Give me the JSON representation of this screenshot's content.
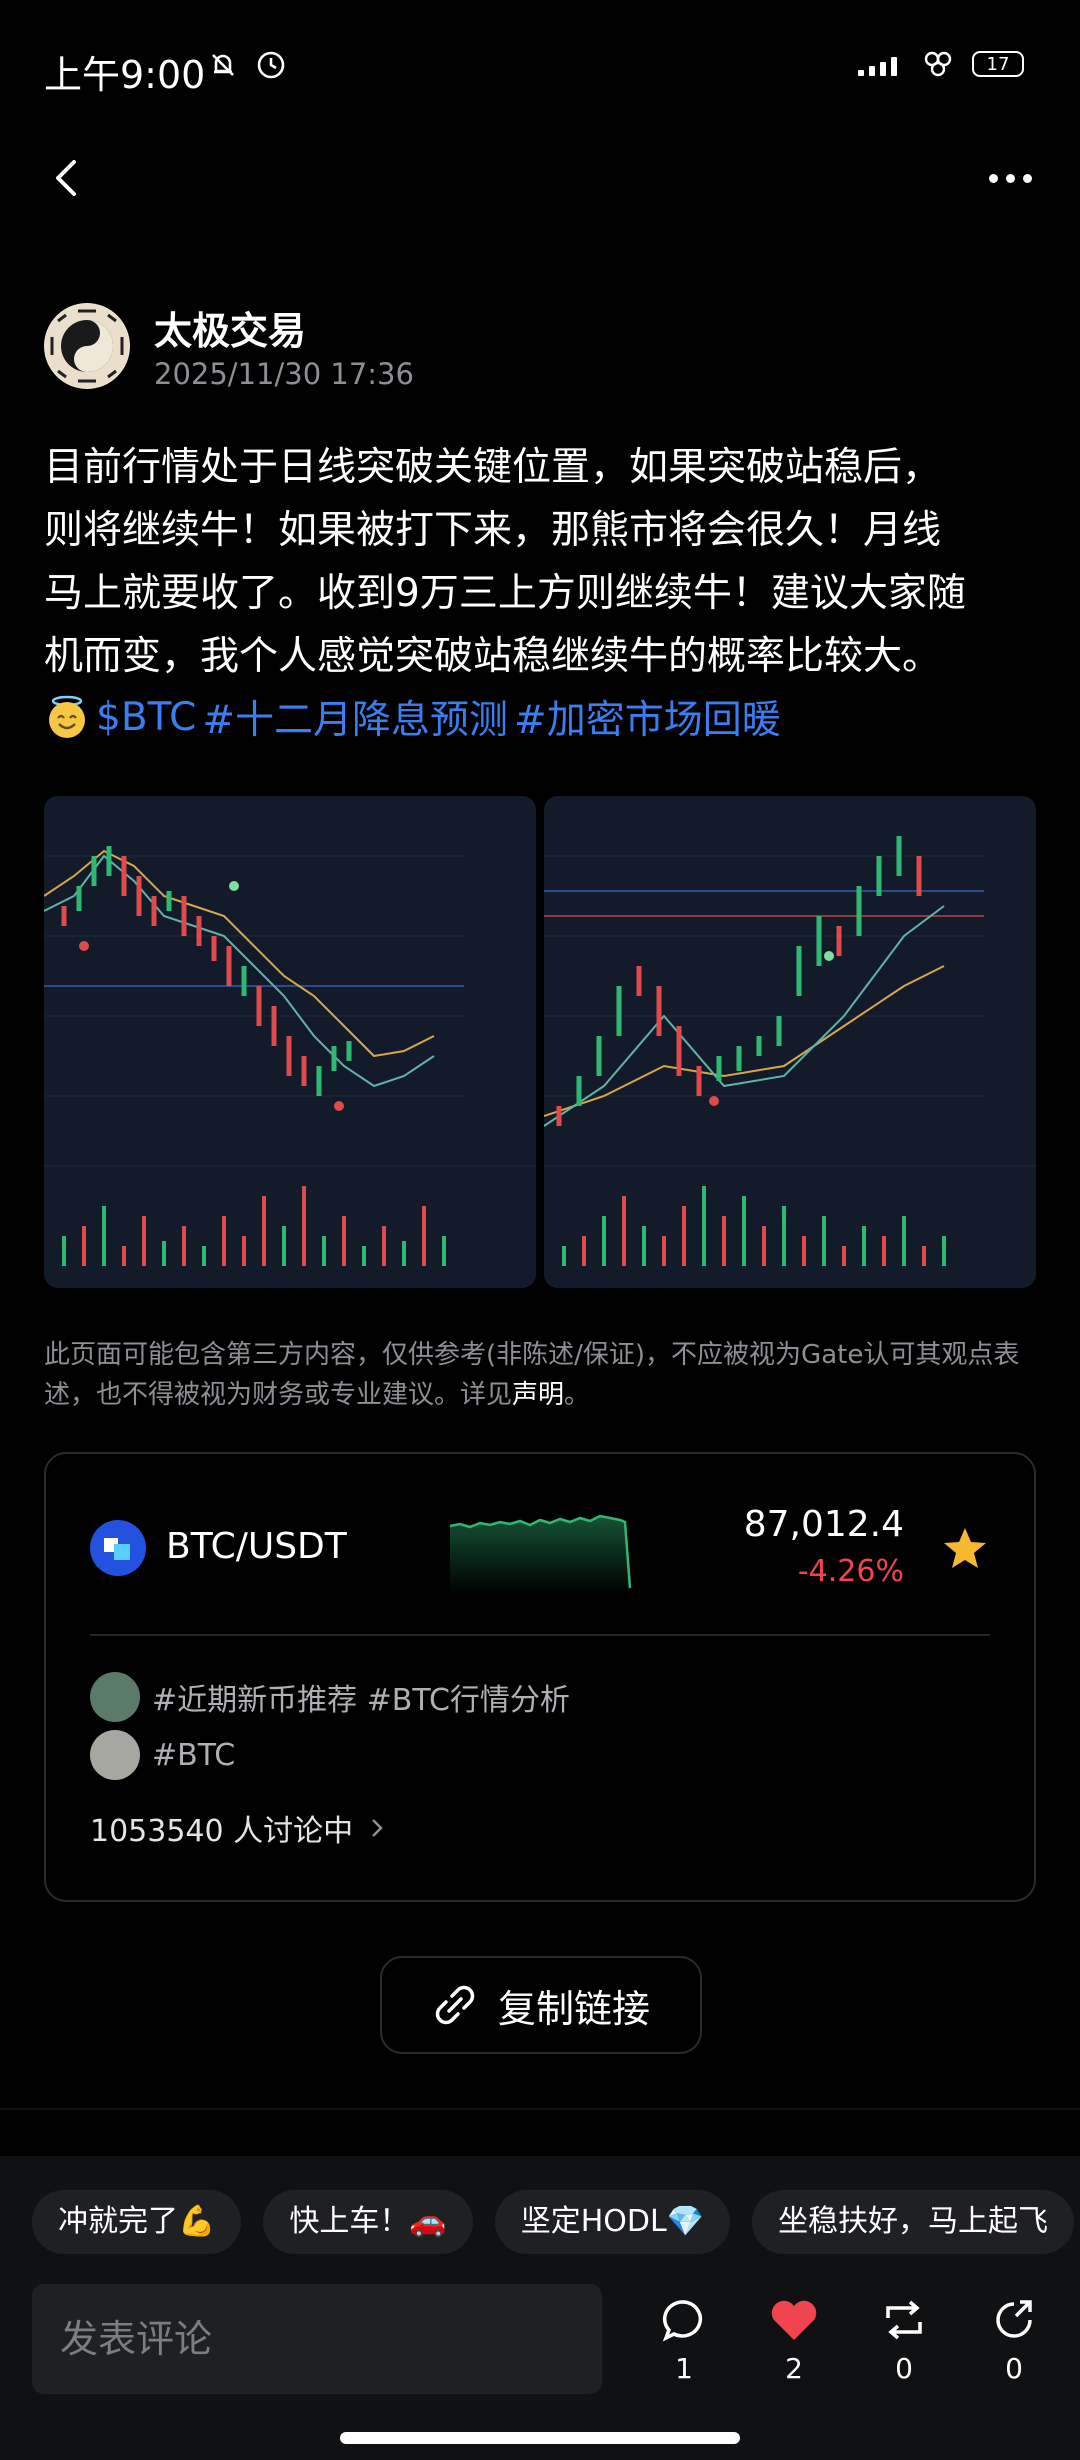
{
  "status_bar": {
    "time": "上午9:00",
    "battery": "17"
  },
  "author": {
    "name": "太极交易",
    "time": "2025/11/30 17:36"
  },
  "post": {
    "lines": [
      "目前行情处于日线突破关键位置，如果突破站稳后，",
      "则将继续牛！如果被打下来，那熊市将会很久！月线",
      "马上就要收了。收到9万三上方则继续牛！建议大家随",
      "机而变，我个人感觉突破站稳继续牛的概率比较大。"
    ],
    "tags": [
      "$BTC",
      "#十二月降息预测",
      "#加密市场回暖"
    ]
  },
  "disclaimer": {
    "text": "此页面可能包含第三方内容，仅供参考(非陈述/保证)，不应被视为Gate认可其观点表述，也不得被视为财务或专业建议。详见",
    "link": "声明",
    "end": "。"
  },
  "market": {
    "pair": "BTC/USDT",
    "price": "87,012.4",
    "change": "-4.26%",
    "topics": [
      "#近期新币推荐 #BTC行情分析",
      "#BTC"
    ],
    "discussing": "1053540 人讨论中"
  },
  "copy_link": "复制链接",
  "quick_replies": [
    "冲就完了💪",
    "快上车！🚗",
    "坚定HODL💎",
    "坐稳扶好，马上起飞"
  ],
  "comment_placeholder": "发表评论",
  "actions": {
    "comments": "1",
    "likes": "2",
    "reposts": "0",
    "shares": "0"
  },
  "colors": {
    "accent_blue": "#3a7ef0",
    "down_red": "#f0444f",
    "up_green": "#2eb872",
    "star": "#f5b82e"
  }
}
